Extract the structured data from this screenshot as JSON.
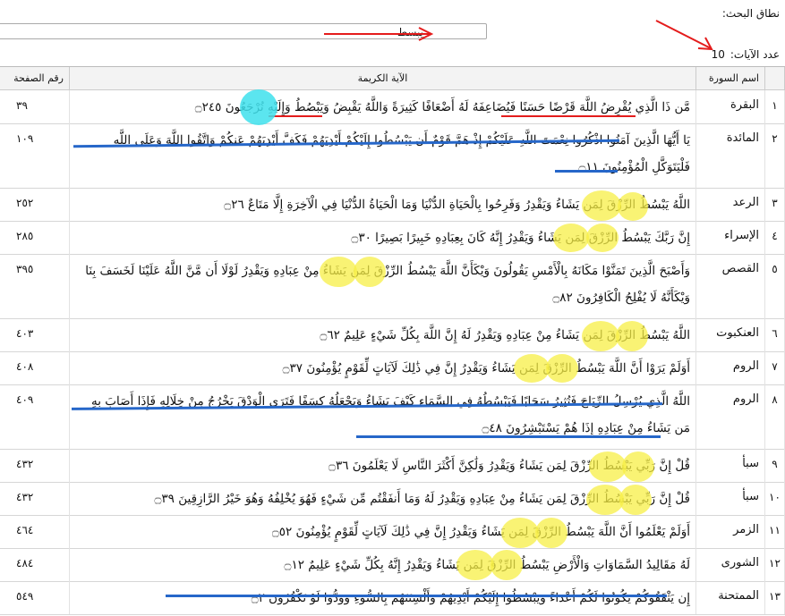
{
  "search": {
    "scope_label": "نطاق البحث:",
    "query": "يبسط",
    "count_label": "عدد الآيات:",
    "count_value": "10"
  },
  "table": {
    "headers": {
      "index": "",
      "sura": "اسم السورة",
      "verse": "الآية الكريمة",
      "page": "رقم الصفحة"
    },
    "rows": [
      {
        "index": "١",
        "sura": "البقرة",
        "page": "٣٩",
        "verse": "مَّن ذَا الَّذِي يُقْرِضُ اللَّهَ قَرْضًا حَسَنًا فَيُضَاعِفَهُ لَهُ أَضْعَافًا كَثِيرَةً وَاللَّهُ يَقْبِضُ وَيَبْصُطُ وَإِلَيْهِ تُرْجَعُونَ ۝٢٤٥"
      },
      {
        "index": "٢",
        "sura": "المائدة",
        "page": "١٠٩",
        "verse": "يَا أَيُّهَا الَّذِينَ آمَنُوا اذْكُرُوا نِعْمَتَ اللَّهِ عَلَيْكُمْ إِذْ هَمَّ قَوْمٌ أَن يَبْسُطُوا إِلَيْكُمْ أَيْدِيَهُمْ فَكَفَّ أَيْدِيَهُمْ عَنكُمْ وَاتَّقُوا اللَّهَ وَعَلَى اللَّهِ فَلْيَتَوَكَّلِ الْمُؤْمِنُونَ ۝١١"
      },
      {
        "index": "٣",
        "sura": "الرعد",
        "page": "٢٥٢",
        "verse": "اللَّهُ يَبْسُطُ الرِّزْقَ لِمَن يَشَاءُ وَيَقْدِرُ وَفَرِحُوا بِالْحَيَاةِ الدُّنْيَا وَمَا الْحَيَاةُ الدُّنْيَا فِي الْآخِرَةِ إِلَّا مَتَاعٌ ۝٢٦"
      },
      {
        "index": "٤",
        "sura": "الإسراء",
        "page": "٢٨٥",
        "verse": "إِنَّ رَبَّكَ يَبْسُطُ الرِّزْقَ لِمَن يَشَاءُ وَيَقْدِرُ إِنَّهُ كَانَ بِعِبَادِهِ خَبِيرًا بَصِيرًا ۝٣٠"
      },
      {
        "index": "٥",
        "sura": "القصص",
        "page": "٣٩٥",
        "verse": "وَأَصْبَحَ الَّذِينَ تَمَنَّوْا مَكَانَهُ بِالْأَمْسِ يَقُولُونَ وَيْكَأَنَّ اللَّهَ يَبْسُطُ الرِّزْقَ لِمَن يَشَاءُ مِنْ عِبَادِهِ وَيَقْدِرُ لَوْلَا أَن مَّنَّ اللَّهُ عَلَيْنَا لَخَسَفَ بِنَا وَيْكَأَنَّهُ لَا يُفْلِحُ الْكَافِرُونَ ۝٨٢"
      },
      {
        "index": "٦",
        "sura": "العنكبوت",
        "page": "٤٠٣",
        "verse": "اللَّهُ يَبْسُطُ الرِّزْقَ لِمَن يَشَاءُ مِنْ عِبَادِهِ وَيَقْدِرُ لَهُ إِنَّ اللَّهَ بِكُلِّ شَيْءٍ عَلِيمٌ ۝٦٢"
      },
      {
        "index": "٧",
        "sura": "الروم",
        "page": "٤٠٨",
        "verse": "أَوَلَمْ يَرَوْا أَنَّ اللَّهَ يَبْسُطُ الرِّزْقَ لِمَن يَشَاءُ وَيَقْدِرُ إِنَّ فِي ذَٰلِكَ لَآيَاتٍ لِّقَوْمٍ يُؤْمِنُونَ ۝٣٧"
      },
      {
        "index": "٨",
        "sura": "الروم",
        "page": "٤٠٩",
        "verse": "اللَّهُ الَّذِي يُرْسِلُ الرِّيَاحَ فَتُثِيرُ سَحَابًا فَيَبْسُطُهُ فِي السَّمَاءِ كَيْفَ يَشَاءُ وَيَجْعَلُهُ كِسَفًا فَتَرَى الْوَدْقَ يَخْرُجُ مِنْ خِلَالِهِ فَإِذَا أَصَابَ بِهِ مَن يَشَاءُ مِنْ عِبَادِهِ إِذَا هُمْ يَسْتَبْشِرُونَ ۝٤٨"
      },
      {
        "index": "٩",
        "sura": "سبأ",
        "page": "٤٣٢",
        "verse": "قُلْ إِنَّ رَبِّي يَبْسُطُ الرِّزْقَ لِمَن يَشَاءُ وَيَقْدِرُ وَلَٰكِنَّ أَكْثَرَ النَّاسِ لَا يَعْلَمُونَ ۝٣٦"
      },
      {
        "index": "١٠",
        "sura": "سبأ",
        "page": "٤٣٢",
        "verse": "قُلْ إِنَّ رَبِّي يَبْسُطُ الرِّزْقَ لِمَن يَشَاءُ مِنْ عِبَادِهِ وَيَقْدِرُ لَهُ وَمَا أَنفَقْتُم مِّن شَيْءٍ فَهُوَ يُخْلِفُهُ وَهُوَ خَيْرُ الرَّازِقِينَ ۝٣٩"
      },
      {
        "index": "١١",
        "sura": "الزمر",
        "page": "٤٦٤",
        "verse": "أَوَلَمْ يَعْلَمُوا أَنَّ اللَّهَ يَبْسُطُ الرِّزْقَ لِمَن يَشَاءُ وَيَقْدِرُ إِنَّ فِي ذَٰلِكَ لَآيَاتٍ لِّقَوْمٍ يُؤْمِنُونَ ۝٥٢"
      },
      {
        "index": "١٢",
        "sura": "الشورى",
        "page": "٤٨٤",
        "verse": "لَهُ مَقَالِيدُ السَّمَاوَاتِ وَالْأَرْضِ يَبْسُطُ الرِّزْقَ لِمَن يَشَاءُ وَيَقْدِرُ إِنَّهُ بِكُلِّ شَيْءٍ عَلِيمٌ ۝١٢"
      },
      {
        "index": "١٣",
        "sura": "الممتحنة",
        "page": "٥٤٩",
        "verse": "إِن يَثْقَفُوكُمْ يَكُونُوا لَكُمْ أَعْدَاءً وَيَبْسُطُوا إِلَيْكُمْ أَيْدِيَهُمْ وَأَلْسِنَتَهُم بِالسُّوءِ وَوَدُّوا لَوْ تَكْفُرُونَ ۝٢"
      }
    ]
  },
  "colors": {
    "highlight": "#f7ef45",
    "cyan": "#3ee1ec",
    "strike": "#2667c9",
    "underline_arrow": "#e41c1c"
  }
}
